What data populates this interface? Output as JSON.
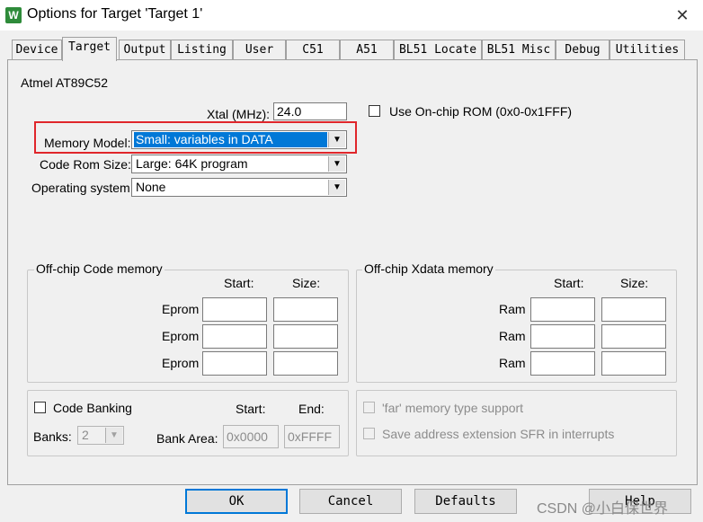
{
  "window": {
    "title": "Options for Target 'Target 1'",
    "close_glyph": "✕",
    "app_icon_glyph": "W"
  },
  "tabs": [
    {
      "label": "Device",
      "active": false
    },
    {
      "label": "Target",
      "active": true
    },
    {
      "label": "Output",
      "active": false
    },
    {
      "label": "Listing",
      "active": false
    },
    {
      "label": "User",
      "active": false
    },
    {
      "label": "C51",
      "active": false
    },
    {
      "label": "A51",
      "active": false
    },
    {
      "label": "BL51 Locate",
      "active": false
    },
    {
      "label": "BL51 Misc",
      "active": false
    },
    {
      "label": "Debug",
      "active": false
    },
    {
      "label": "Utilities",
      "active": false
    }
  ],
  "device_name": "Atmel AT89C52",
  "xtal": {
    "label": "Xtal (MHz):",
    "value": "24.0"
  },
  "use_onchip_rom": {
    "label": "Use On-chip ROM (0x0-0x1FFF)",
    "checked": false
  },
  "memory_model": {
    "label": "Memory Model:",
    "value": "Small: variables in DATA"
  },
  "code_rom_size": {
    "label": "Code Rom Size:",
    "value": "Large: 64K program"
  },
  "operating_system": {
    "label": "Operating system:",
    "value": "None"
  },
  "offchip_code": {
    "title": "Off-chip Code memory",
    "start_header": "Start:",
    "size_header": "Size:",
    "rows": [
      {
        "label": "Eprom",
        "start": "",
        "size": ""
      },
      {
        "label": "Eprom",
        "start": "",
        "size": ""
      },
      {
        "label": "Eprom",
        "start": "",
        "size": ""
      }
    ]
  },
  "offchip_xdata": {
    "title": "Off-chip Xdata memory",
    "start_header": "Start:",
    "size_header": "Size:",
    "rows": [
      {
        "label": "Ram",
        "start": "",
        "size": ""
      },
      {
        "label": "Ram",
        "start": "",
        "size": ""
      },
      {
        "label": "Ram",
        "start": "",
        "size": ""
      }
    ]
  },
  "code_banking": {
    "label": "Code Banking",
    "checked": false,
    "start_header": "Start:",
    "end_header": "End:",
    "banks_label": "Banks:",
    "banks_value": "2",
    "bank_area_label": "Bank Area:",
    "bank_area_start": "0x0000",
    "bank_area_end": "0xFFFF"
  },
  "far_memory": {
    "label": "'far' memory type support",
    "checked": false
  },
  "save_sfr": {
    "label": "Save address extension SFR in interrupts",
    "checked": false
  },
  "buttons": {
    "ok": "OK",
    "cancel": "Cancel",
    "defaults": "Defaults",
    "help": "Help"
  },
  "watermark": "CSDN @小白保世界",
  "colors": {
    "highlight": "#e0262b",
    "selection": "#0078d7"
  }
}
